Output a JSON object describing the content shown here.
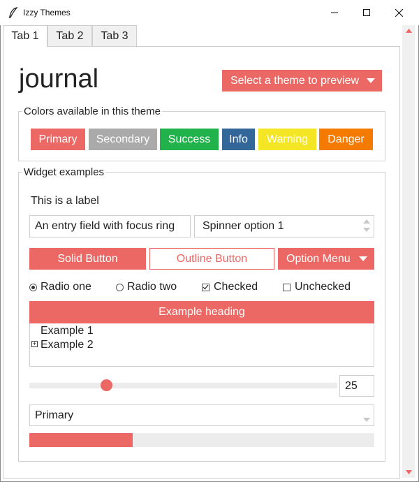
{
  "window": {
    "title": "Izzy Themes",
    "controls": [
      "minimize-icon",
      "maximize-icon",
      "close-icon"
    ]
  },
  "tabs": [
    {
      "label": "Tab 1",
      "selected": true
    },
    {
      "label": "Tab 2",
      "selected": false
    },
    {
      "label": "Tab 3",
      "selected": false
    }
  ],
  "header": {
    "theme_name": "journal",
    "theme_select_label": "Select a theme to preview"
  },
  "colors": {
    "legend": "Colors available in this theme",
    "items": [
      {
        "label": "Primary",
        "color": "#eb6864"
      },
      {
        "label": "Secondary",
        "color": "#aaaaaa"
      },
      {
        "label": "Success",
        "color": "#22b24c"
      },
      {
        "label": "Info",
        "color": "#336699"
      },
      {
        "label": "Warning",
        "color": "#f5e625"
      },
      {
        "label": "Danger",
        "color": "#f57a00"
      }
    ]
  },
  "widgets": {
    "legend": "Widget examples",
    "label": "This is a label",
    "entry_value": "An entry field with focus ring",
    "spinner_value": "Spinner option 1",
    "solid_button": "Solid Button",
    "outline_button": "Outline Button",
    "option_menu": "Option Menu",
    "radio_one": "Radio one",
    "radio_one_selected": true,
    "radio_two": "Radio two",
    "radio_two_selected": false,
    "checked_label": "Checked",
    "checked_state": true,
    "unchecked_label": "Unchecked",
    "unchecked_state": false,
    "tree": {
      "heading": "Example heading",
      "rows": [
        "Example 1",
        "Example 2"
      ]
    },
    "scale_value": "25",
    "scale_fraction": 0.25,
    "combo_value": "Primary",
    "progress_fraction": 0.3
  },
  "accent_color": "#eb6864"
}
